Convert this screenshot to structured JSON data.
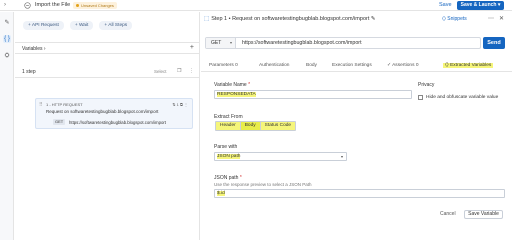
{
  "topbar": {
    "title": "Import the File",
    "unsaved": "Unsaved Changes",
    "save": "Save",
    "save_launch": "Save & Launch",
    "launch_chevron": "▾"
  },
  "left": {
    "buttons": [
      "API Request",
      "Wait",
      "All Steps"
    ],
    "variables_label": "Variables",
    "steps_label": "1 step",
    "select_label": "Select",
    "card": {
      "header": "1 - HTTP REQUEST",
      "counter": "1",
      "subtitle": "Request on softwaretestingbugblab.blogspot.com/import",
      "method": "GET",
      "url": "https://softwaretestingbugblab.blogspot.com/import"
    }
  },
  "main": {
    "step_title": "Step 1 • Request on softwaretestingbugblab.blogspot.com/import",
    "snippets": "Snippets",
    "method": "GET",
    "url": "https://softwaretestingbugblab.blogspot.com/import",
    "send": "Send",
    "tabs": [
      {
        "label": "Parameters",
        "count": "0"
      },
      {
        "label": "Authentication",
        "count": ""
      },
      {
        "label": "Body",
        "count": ""
      },
      {
        "label": "Execution Settings",
        "count": ""
      },
      {
        "label": "Assertions",
        "count": "0"
      },
      {
        "label": "Extracted Variables",
        "count": ""
      }
    ],
    "variable_name_label": "Variable Name",
    "variable_name_value": "RESPONSEDATA",
    "privacy_label": "Privacy",
    "hide_label": "Hide and obfuscate variable value",
    "extract_from_label": "Extract From",
    "extract_options": [
      "Header",
      "Body",
      "Status Code"
    ],
    "extract_selected": "Body",
    "parse_with_label": "Parse with",
    "parse_with_value": "JSON path",
    "json_path_label": "JSON path",
    "json_path_hint": "Use the response preview to select a JSON Path",
    "json_path_value": "$.id",
    "cancel": "Cancel",
    "save_variable": "Save Variable"
  },
  "colors": {
    "accent": "#1565c0",
    "highlight": "#f5f57a"
  }
}
